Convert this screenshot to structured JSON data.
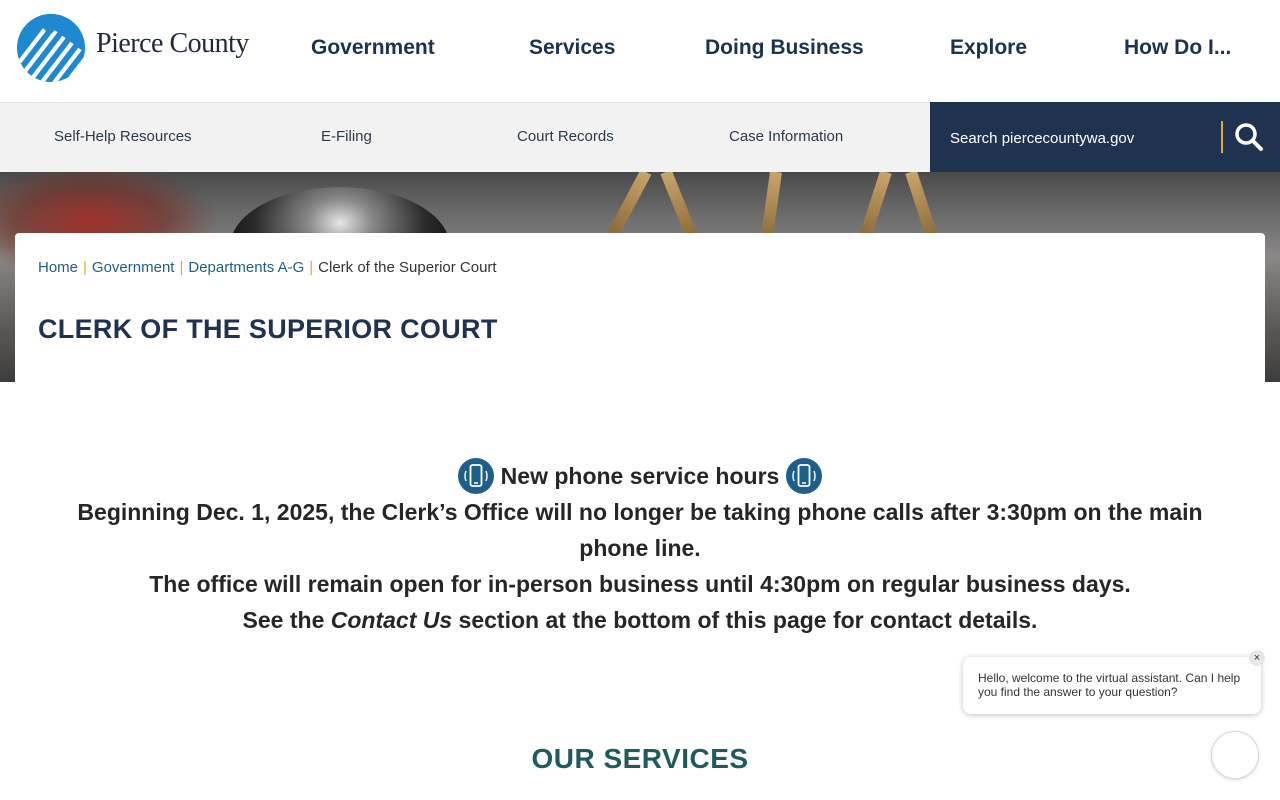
{
  "site": {
    "logo_text": "Pierce County",
    "logo_icon": "pierce-county-mountain-logo"
  },
  "main_nav": [
    {
      "label": "Government"
    },
    {
      "label": "Services"
    },
    {
      "label": "Doing Business"
    },
    {
      "label": "Explore"
    },
    {
      "label": "How Do I..."
    }
  ],
  "sub_nav": [
    {
      "label": "Self-Help Resources"
    },
    {
      "label": "E-Filing"
    },
    {
      "label": "Court Records"
    },
    {
      "label": "Case Information"
    }
  ],
  "search": {
    "placeholder": "Search piercecountywa.gov",
    "icon": "search-icon"
  },
  "breadcrumb": {
    "items": [
      "Home",
      "Government",
      "Departments A-G"
    ],
    "current": "Clerk of the Superior Court",
    "separator": "|"
  },
  "page_title": "CLERK OF THE SUPERIOR COURT",
  "notice": {
    "heading": "New phone service hours",
    "icon": "phone-icon",
    "line1": "Beginning Dec. 1, 2025, the Clerk’s Office will no longer be taking phone calls after 3:30pm on the main phone line.",
    "line2": "The office will remain open for in-person business until 4:30pm on regular business days.",
    "line3_before": "See the ",
    "line3_link": "Contact Us",
    "line3_after": " section at the bottom of this page for contact details."
  },
  "services_title": "OUR SERVICES",
  "chat": {
    "message": "Hello, welcome to the virtual assistant. Can I help you find the answer to your question?",
    "close_label": "×"
  },
  "colors": {
    "navy": "#1f3350",
    "nav_text": "#1a3350",
    "link": "#1d5f8a",
    "accent": "#e4a826",
    "teal": "#1f5a5c",
    "logo_blue": "#1e88d0"
  }
}
